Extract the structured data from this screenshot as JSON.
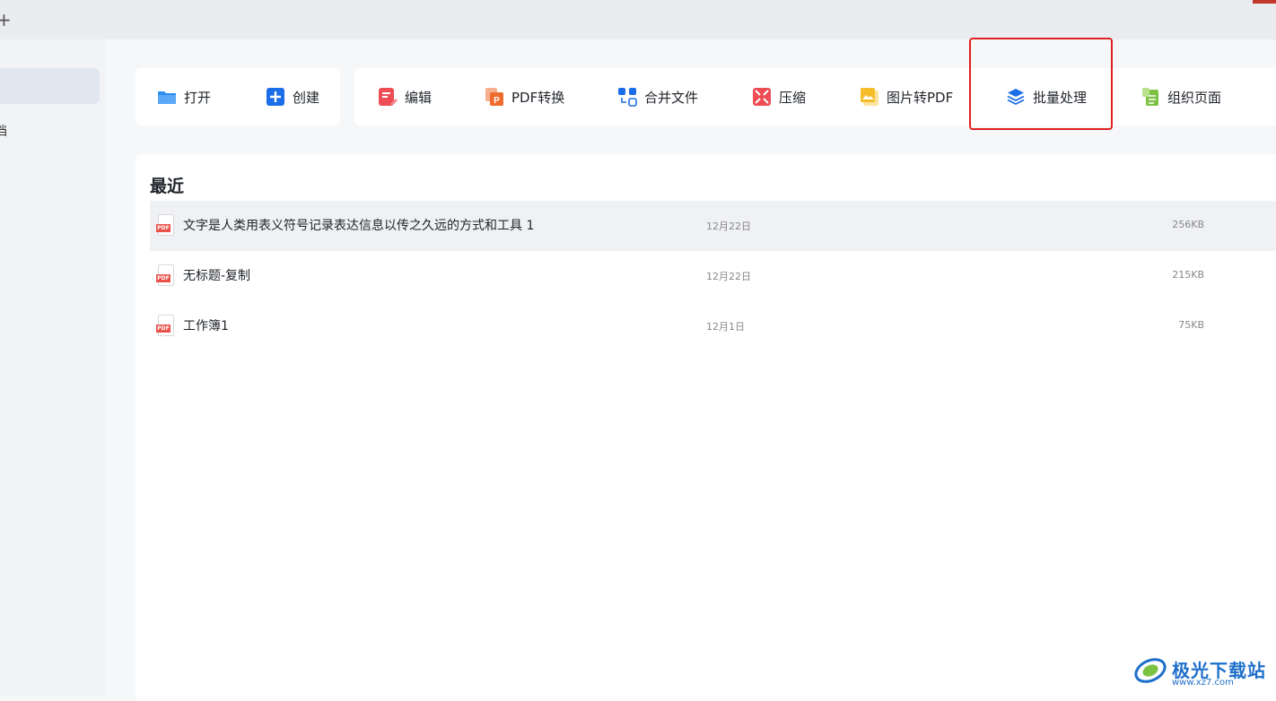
{
  "topbar": {
    "new_tab_symbol": "+"
  },
  "sidebar": {
    "truncated_label": "档"
  },
  "toolbar": {
    "open": "打开",
    "create": "创建",
    "edit": "编辑",
    "pdf_convert": "PDF转换",
    "merge": "合并文件",
    "compress": "压缩",
    "image_to_pdf": "图片转PDF",
    "batch": "批量处理",
    "organize": "组织页面"
  },
  "recent": {
    "title": "最近",
    "files": [
      {
        "name": "文字是人类用表义符号记录表达信息以传之久远的方式和工具 1",
        "date": "12月22日",
        "size": "256KB",
        "icon": "PDF"
      },
      {
        "name": "无标题-复制",
        "date": "12月22日",
        "size": "215KB",
        "icon": "PDF"
      },
      {
        "name": "工作簿1",
        "date": "12月1日",
        "size": "75KB",
        "icon": "PDF"
      }
    ]
  },
  "watermark": {
    "text": "极光下载站",
    "url": "www.xz7.com"
  },
  "colors": {
    "highlight": "#e02020",
    "accent": "#1b6ee8",
    "pdf_red": "#e9534b"
  }
}
